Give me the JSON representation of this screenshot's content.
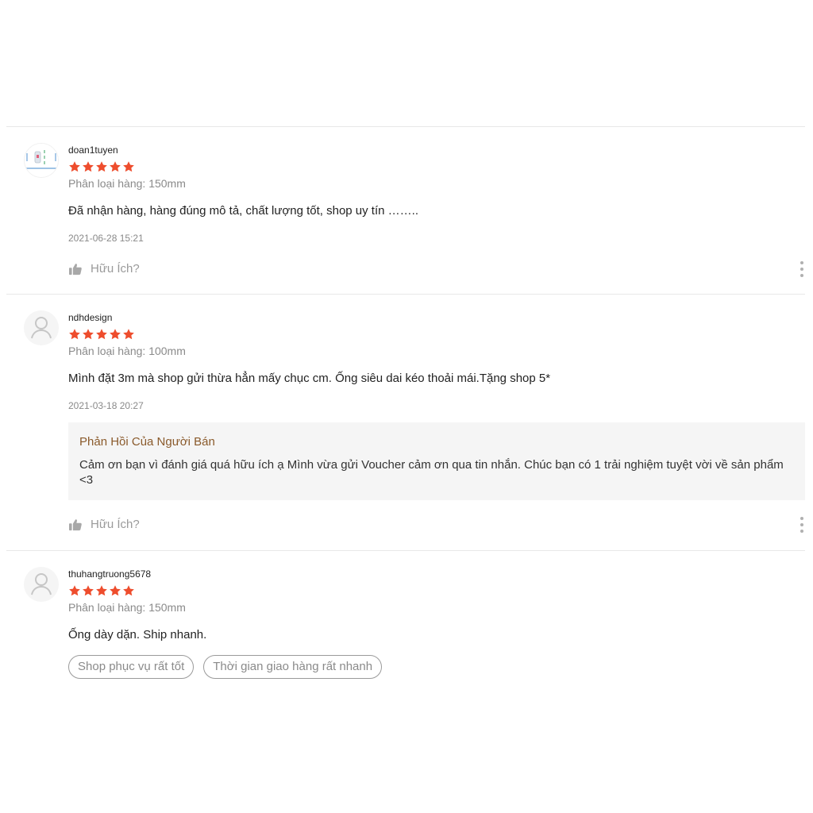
{
  "colors": {
    "star": "#ee4d2d",
    "reply_title": "#8a5a2b",
    "muted": "#8a8a8a"
  },
  "reviews": [
    {
      "username": "doan1tuyen",
      "rating": 5,
      "variation": "Phân loại hàng: 150mm",
      "comment": "Đã nhận hàng, hàng đúng mô tả, chất lượng tốt, shop uy tín ……..",
      "date": "2021-06-28 15:21",
      "helpful_label": "Hữu Ích?"
    },
    {
      "username": "ndhdesign",
      "rating": 5,
      "variation": "Phân loại hàng: 100mm",
      "comment": "Mình đặt 3m mà shop gửi thừa hẳn mấy chục cm. Ống siêu dai kéo thoải mái.Tặng shop 5*",
      "date": "2021-03-18 20:27",
      "seller_reply": {
        "title": "Phản Hồi Của Người Bán",
        "text": "Cảm ơn bạn vì đánh giá quá hữu ích ạ Mình vừa gửi Voucher cảm ơn qua tin nhắn. Chúc bạn có 1 trải nghiệm tuyệt vời về sản phẩm <3"
      },
      "helpful_label": "Hữu Ích?"
    },
    {
      "username": "thuhangtruong5678",
      "rating": 5,
      "variation": "Phân loại hàng: 150mm",
      "comment": "Ống dày dặn. Ship nhanh.",
      "tags": [
        "Shop phục vụ rất tốt",
        "Thời gian giao hàng rất nhanh"
      ]
    }
  ]
}
